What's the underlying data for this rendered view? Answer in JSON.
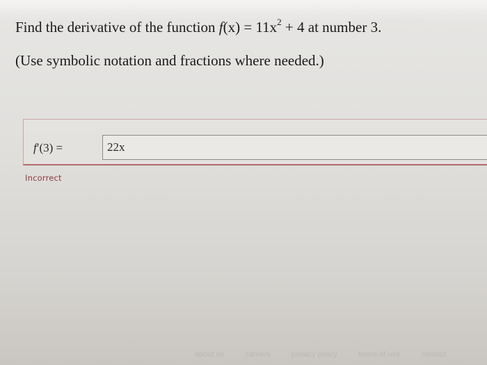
{
  "question": {
    "prefix": "Find the derivative of the function ",
    "function_name": "f",
    "function_arg": "(x) = 11x",
    "exponent": "2",
    "suffix": " + 4 at number 3."
  },
  "hint": "(Use symbolic notation and fractions where needed.)",
  "answer": {
    "label_fn": "f",
    "label_rest": "′(3) =",
    "input_value": "22x"
  },
  "feedback": "Incorrect",
  "footer": {
    "links": [
      "about us",
      "careers",
      "privacy policy",
      "terms of use",
      "contact"
    ]
  },
  "colors": {
    "incorrect": "#8a3a3a",
    "answer_border": "#b46a6a"
  }
}
